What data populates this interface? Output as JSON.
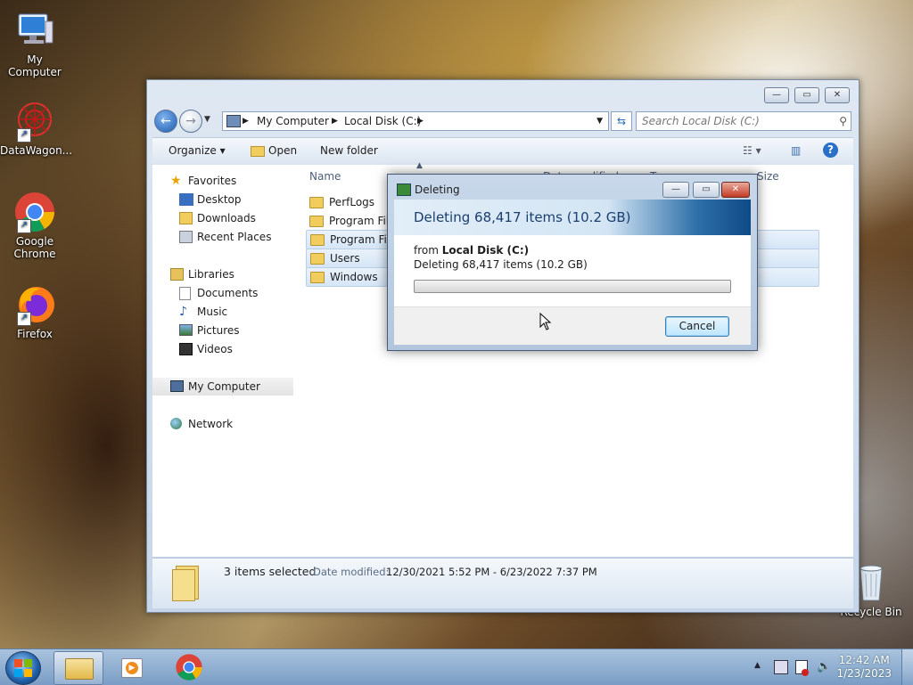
{
  "desktop": {
    "icons": [
      {
        "label": "My Computer",
        "icon": "computer-icon"
      },
      {
        "label": "DataWagon...",
        "icon": "datawagon-icon"
      },
      {
        "label": "Google Chrome",
        "icon": "chrome-icon"
      },
      {
        "label": "Firefox",
        "icon": "firefox-icon"
      },
      {
        "label": "Recycle Bin",
        "icon": "recycle-bin-icon"
      }
    ]
  },
  "explorer": {
    "caption_buttons": {
      "minimize": "—",
      "maximize": "▭",
      "close": "✕"
    },
    "breadcrumb": [
      "My Computer",
      "Local Disk (C:)"
    ],
    "search_placeholder": "Search Local Disk (C:)",
    "toolbar": {
      "organize": "Organize ▾",
      "open": "Open",
      "new_folder": "New folder"
    },
    "nav": {
      "favorites": "Favorites",
      "favorites_items": [
        "Desktop",
        "Downloads",
        "Recent Places"
      ],
      "libraries": "Libraries",
      "libraries_items": [
        "Documents",
        "Music",
        "Pictures",
        "Videos"
      ],
      "computer": "My Computer",
      "network": "Network"
    },
    "columns": {
      "name": "Name",
      "date": "Date modified",
      "type": "Type",
      "size": "Size"
    },
    "files": [
      {
        "name": "PerfLogs",
        "selected": false
      },
      {
        "name": "Program Files",
        "selected": false
      },
      {
        "name": "Program Files (x86)",
        "selected": true
      },
      {
        "name": "Users",
        "selected": true
      },
      {
        "name": "Windows",
        "selected": true
      }
    ],
    "status": {
      "selected": "3 items selected",
      "date_label": "Date modified:",
      "date_range": "12/30/2021 5:52 PM - 6/23/2022 7:37 PM"
    }
  },
  "dialog": {
    "title": "Deleting",
    "heading": "Deleting 68,417 items (10.2 GB)",
    "from_label": "from",
    "from_location": "Local Disk (C:)",
    "detail": "Deleting 68,417 items (10.2 GB)",
    "progress": 0,
    "cancel_label": "Cancel",
    "caption_buttons": {
      "minimize": "—",
      "maximize": "▭",
      "close": "✕"
    }
  },
  "taskbar": {
    "time": "12:42 AM",
    "date": "1/23/2023",
    "tray_arrow": "▲"
  },
  "colors": {
    "accent": "#1a5fb4",
    "selection": "#d6e6f7",
    "progress": "#2fa82a"
  }
}
